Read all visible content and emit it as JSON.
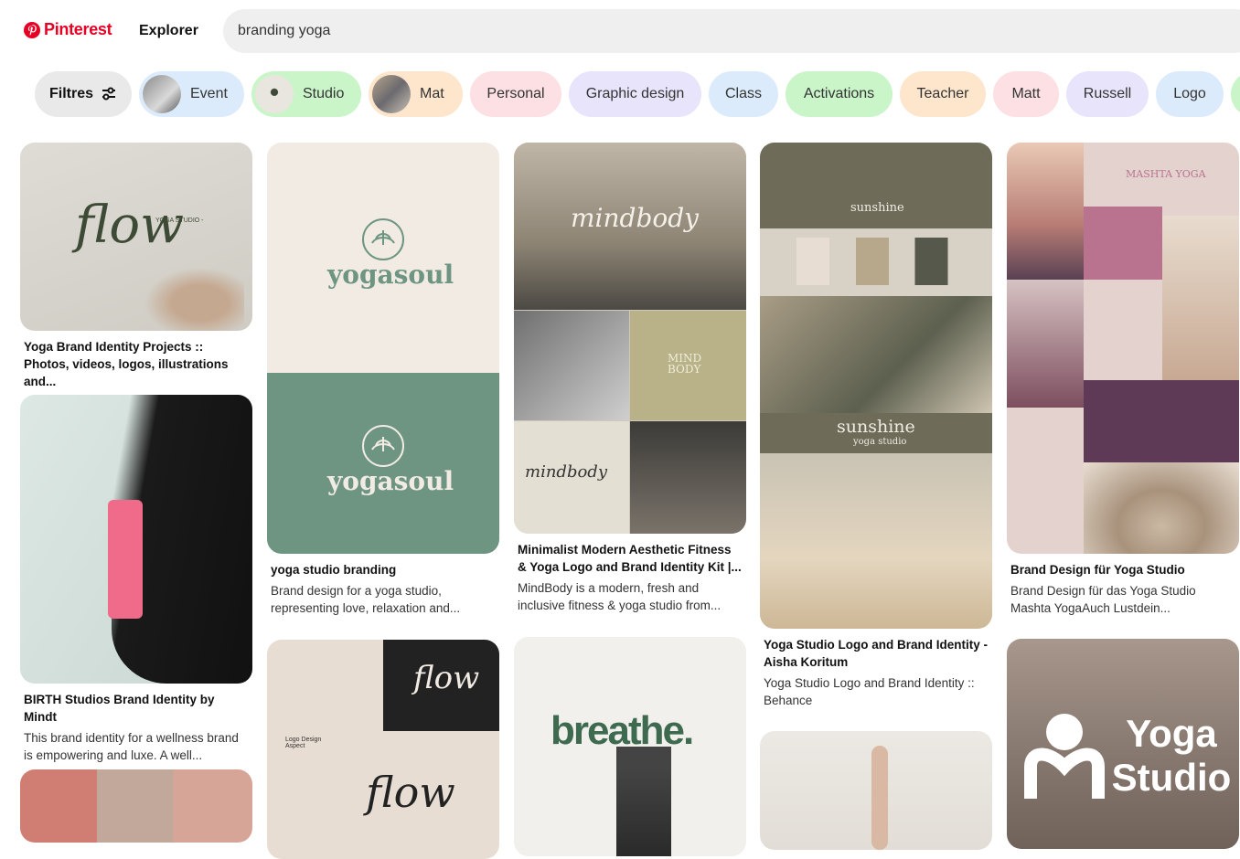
{
  "header": {
    "logo_text": "Pinterest",
    "nav_explorer": "Explorer",
    "search_value": "branding yoga"
  },
  "chips": [
    {
      "label": "Filtres",
      "color": "#e9e9e9"
    },
    {
      "label": "Event",
      "color": "#dcebfb"
    },
    {
      "label": "Studio",
      "color": "#c9f5c9"
    },
    {
      "label": "Mat",
      "color": "#fde6cc"
    },
    {
      "label": "Personal",
      "color": "#fde0e3"
    },
    {
      "label": "Graphic design",
      "color": "#e7e4fb"
    },
    {
      "label": "Class",
      "color": "#dcebfb"
    },
    {
      "label": "Activations",
      "color": "#c9f5c9"
    },
    {
      "label": "Teacher",
      "color": "#fde6cc"
    },
    {
      "label": "Matt",
      "color": "#fde0e3"
    },
    {
      "label": "Russell",
      "color": "#e7e4fb"
    },
    {
      "label": "Logo",
      "color": "#dcebfb"
    }
  ],
  "pins": {
    "p1": {
      "title": "Yoga Brand Identity Projects :: Photos, videos, logos, illustrations and...",
      "img_word": "flow",
      "img_sub": "YOGA STUDIO -"
    },
    "p2": {
      "title": "BIRTH Studios Brand Identity by Mindt",
      "desc": "This brand identity for a wellness brand is empowering and luxe. A well..."
    },
    "p3": {
      "title": "yoga studio branding",
      "desc": "Brand design for a yoga studio, representing love, relaxation and...",
      "img_word": "yogasoul"
    },
    "p4": {
      "img_word": "flow",
      "img_sub": "Logo Design Aspect"
    },
    "p5": {
      "title": "Minimalist Modern Aesthetic Fitness & Yoga Logo and Brand Identity Kit |...",
      "desc": "MindBody is a modern, fresh and inclusive fitness & yoga studio from...",
      "img_word": "mindbody",
      "img_sub": "MIND BODY"
    },
    "p6": {
      "img_word": "breathe."
    },
    "p7": {
      "title": "Yoga Studio Logo and Brand Identity - Aisha Koritum",
      "desc": "Yoga Studio Logo and Brand Identity :: Behance",
      "img_word": "sunshine",
      "img_sub": "yoga studio"
    },
    "p9": {
      "title": "Brand Design für Yoga Studio",
      "desc": "Brand Design für das Yoga Studio Mashta YogaAuch Lustdein...",
      "img_word": "MASHTA YOGA"
    },
    "p10": {
      "img_word": "Yoga Studio"
    }
  }
}
